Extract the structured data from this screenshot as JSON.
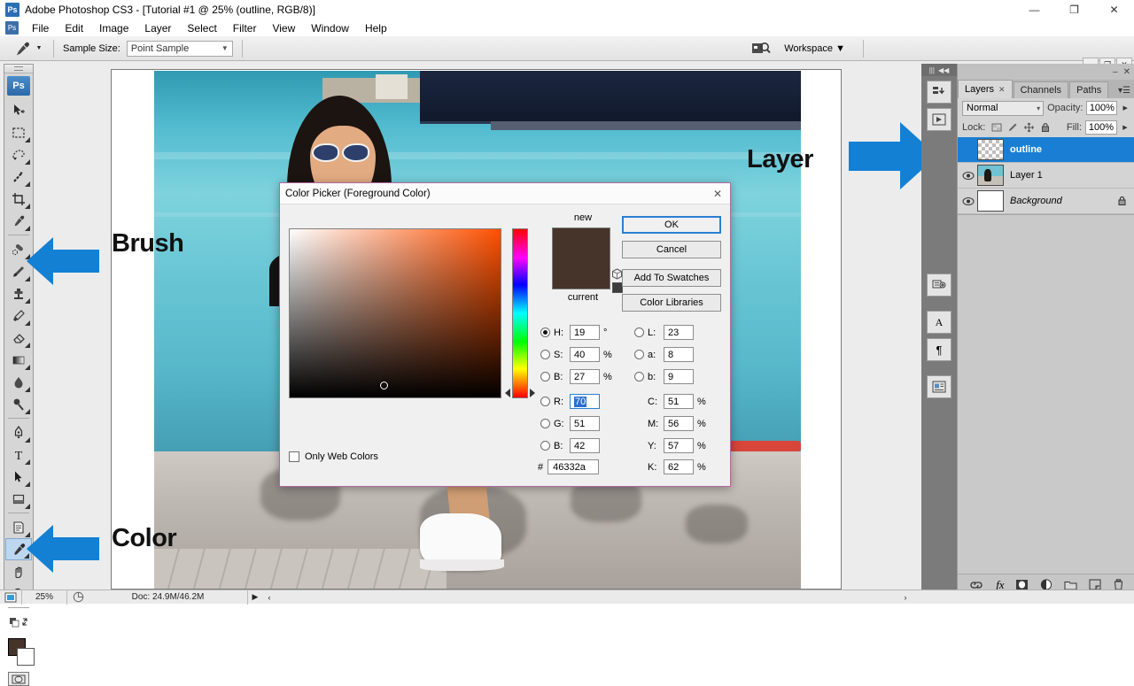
{
  "window": {
    "title": "Adobe Photoshop CS3 - [Tutorial #1 @ 25% (outline, RGB/8)]",
    "app_badge": "Ps",
    "minimize": "—",
    "restore": "❐",
    "close": "✕"
  },
  "menu": {
    "badge": "Ps",
    "items": [
      "File",
      "Edit",
      "Image",
      "Layer",
      "Select",
      "Filter",
      "View",
      "Window",
      "Help"
    ]
  },
  "inner_window": {
    "minimize": "–",
    "restore": "❐",
    "close": "✕"
  },
  "options_bar": {
    "tool_icon": "eyedropper-icon",
    "sample_size_label": "Sample Size:",
    "sample_size_value": "Point Sample",
    "workspace_label": "Workspace",
    "workspace_caret": "▼"
  },
  "toolbox": {
    "badge": "Ps",
    "tools": [
      {
        "name": "move-tool",
        "active": false
      },
      {
        "name": "marquee-tool",
        "active": false
      },
      {
        "name": "lasso-tool",
        "active": false
      },
      {
        "name": "magic-wand-tool",
        "active": false
      },
      {
        "name": "crop-tool",
        "active": false
      },
      {
        "name": "slice-tool",
        "active": false
      },
      {
        "name": "healing-brush-tool",
        "active": false
      },
      {
        "name": "brush-tool",
        "active": false
      },
      {
        "name": "clone-stamp-tool",
        "active": false
      },
      {
        "name": "history-brush-tool",
        "active": false
      },
      {
        "name": "eraser-tool",
        "active": false
      },
      {
        "name": "gradient-tool",
        "active": false
      },
      {
        "name": "blur-tool",
        "active": false
      },
      {
        "name": "dodge-tool",
        "active": false
      },
      {
        "name": "pen-tool",
        "active": false
      },
      {
        "name": "type-tool",
        "active": false
      },
      {
        "name": "path-selection-tool",
        "active": false
      },
      {
        "name": "shape-tool",
        "active": false
      },
      {
        "name": "notes-tool",
        "active": false
      },
      {
        "name": "eyedropper-tool",
        "active": true
      },
      {
        "name": "hand-tool",
        "active": false
      },
      {
        "name": "zoom-tool",
        "active": false
      }
    ],
    "foreground_color": "#46332a",
    "background_color": "#ffffff"
  },
  "annotations": [
    {
      "label": "Layer",
      "arrow": "right"
    },
    {
      "label": "Brush",
      "arrow": "left"
    },
    {
      "label": "Color",
      "arrow": "left"
    }
  ],
  "panels": {
    "tabs": [
      {
        "label": "Layers",
        "active": true,
        "closable": true
      },
      {
        "label": "Channels",
        "active": false,
        "closable": false
      },
      {
        "label": "Paths",
        "active": false,
        "closable": false
      }
    ],
    "blend_mode": "Normal",
    "opacity_label": "Opacity:",
    "opacity_value": "100%",
    "lock_label": "Lock:",
    "fill_label": "Fill:",
    "fill_value": "100%",
    "layers": [
      {
        "name": "outline",
        "visible": false,
        "selected": true,
        "locked": false,
        "italic": false,
        "thumb": "checker"
      },
      {
        "name": "Layer 1",
        "visible": true,
        "selected": false,
        "locked": false,
        "italic": false,
        "thumb": "photo"
      },
      {
        "name": "Background",
        "visible": true,
        "selected": false,
        "locked": true,
        "italic": true,
        "thumb": "white"
      }
    ],
    "bottom_buttons": [
      "link-icon",
      "fx-icon",
      "mask-icon",
      "adjustment-icon",
      "group-icon",
      "new-layer-icon",
      "delete-icon"
    ]
  },
  "mini_dock": {
    "buttons": [
      "history-icon",
      "actions-icon",
      "color-icon",
      "brushes-icon",
      "character-icon",
      "paragraph-icon",
      "layer-comps-icon"
    ],
    "character_glyph": "A",
    "paragraph_glyph": "¶"
  },
  "status_bar": {
    "zoom": "25%",
    "doc_info": "Doc: 24.9M/46.2M",
    "arrow": "▶",
    "left_chevron": "‹",
    "right_chevron": "›"
  },
  "color_picker": {
    "title": "Color Picker (Foreground Color)",
    "close": "✕",
    "new_label": "new",
    "current_label": "current",
    "new_color": "#46332a",
    "current_color": "#46332a",
    "warning_swatch": "#3d3d3d",
    "buttons": {
      "ok": "OK",
      "cancel": "Cancel",
      "add_to_swatches": "Add To Swatches",
      "color_libraries": "Color Libraries"
    },
    "only_web_colors": "Only Web Colors",
    "hex_symbol": "#",
    "hex_value": "46332a",
    "hsb": [
      {
        "key": "H:",
        "value": "19",
        "unit": "°",
        "selected": true
      },
      {
        "key": "S:",
        "value": "40",
        "unit": "%",
        "selected": false
      },
      {
        "key": "B:",
        "value": "27",
        "unit": "%",
        "selected": false
      }
    ],
    "rgb": [
      {
        "key": "R:",
        "value": "70",
        "unit": "",
        "selected": false,
        "focused": true
      },
      {
        "key": "G:",
        "value": "51",
        "unit": "",
        "selected": false,
        "focused": false
      },
      {
        "key": "B:",
        "value": "42",
        "unit": "",
        "selected": false,
        "focused": false
      }
    ],
    "lab": [
      {
        "key": "L:",
        "value": "23",
        "unit": "",
        "selected": false
      },
      {
        "key": "a:",
        "value": "8",
        "unit": "",
        "selected": false
      },
      {
        "key": "b:",
        "value": "9",
        "unit": "",
        "selected": false
      }
    ],
    "cmyk": [
      {
        "key": "C:",
        "value": "51",
        "unit": "%"
      },
      {
        "key": "M:",
        "value": "56",
        "unit": "%"
      },
      {
        "key": "Y:",
        "value": "57",
        "unit": "%"
      },
      {
        "key": "K:",
        "value": "62",
        "unit": "%"
      }
    ]
  },
  "colors": {
    "accent_blue": "#1380d4",
    "selection_blue": "#1a7fd4",
    "dialog_border": "#b06a9e"
  }
}
